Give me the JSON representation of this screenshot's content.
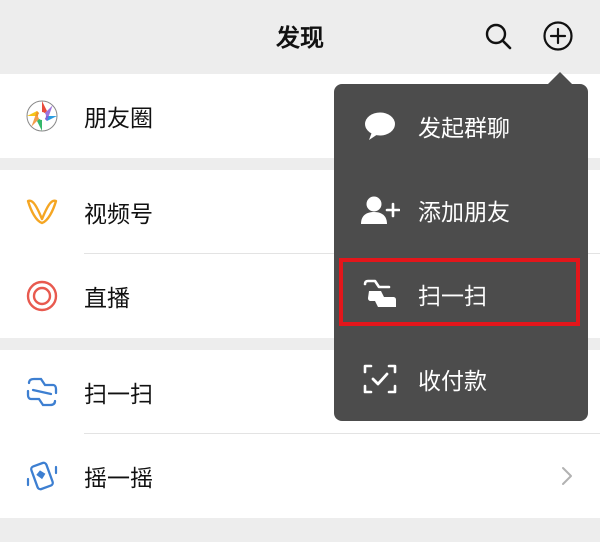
{
  "header": {
    "title": "发现",
    "search_icon": "search-icon",
    "add_icon": "plus-circle-icon"
  },
  "list": {
    "groups": [
      {
        "items": [
          {
            "label": "朋友圈",
            "icon": "moments-icon"
          }
        ]
      },
      {
        "items": [
          {
            "label": "视频号",
            "icon": "channels-icon"
          },
          {
            "label": "直播",
            "icon": "live-icon"
          }
        ]
      },
      {
        "items": [
          {
            "label": "扫一扫",
            "icon": "scan-icon"
          },
          {
            "label": "摇一摇",
            "icon": "shake-icon"
          }
        ]
      }
    ]
  },
  "popup_menu": {
    "items": [
      {
        "label": "发起群聊",
        "icon": "chat-bubble-icon"
      },
      {
        "label": "添加朋友",
        "icon": "add-friend-icon"
      },
      {
        "label": "扫一扫",
        "icon": "scan-icon",
        "highlighted": true
      },
      {
        "label": "收付款",
        "icon": "payment-icon"
      }
    ]
  },
  "colors": {
    "background": "#ededed",
    "popup": "#4c4c4c",
    "highlight": "#e3161b",
    "channels_orange": "#f5a623",
    "live_red": "#e85a4f",
    "scan_blue": "#3d7fd1"
  }
}
